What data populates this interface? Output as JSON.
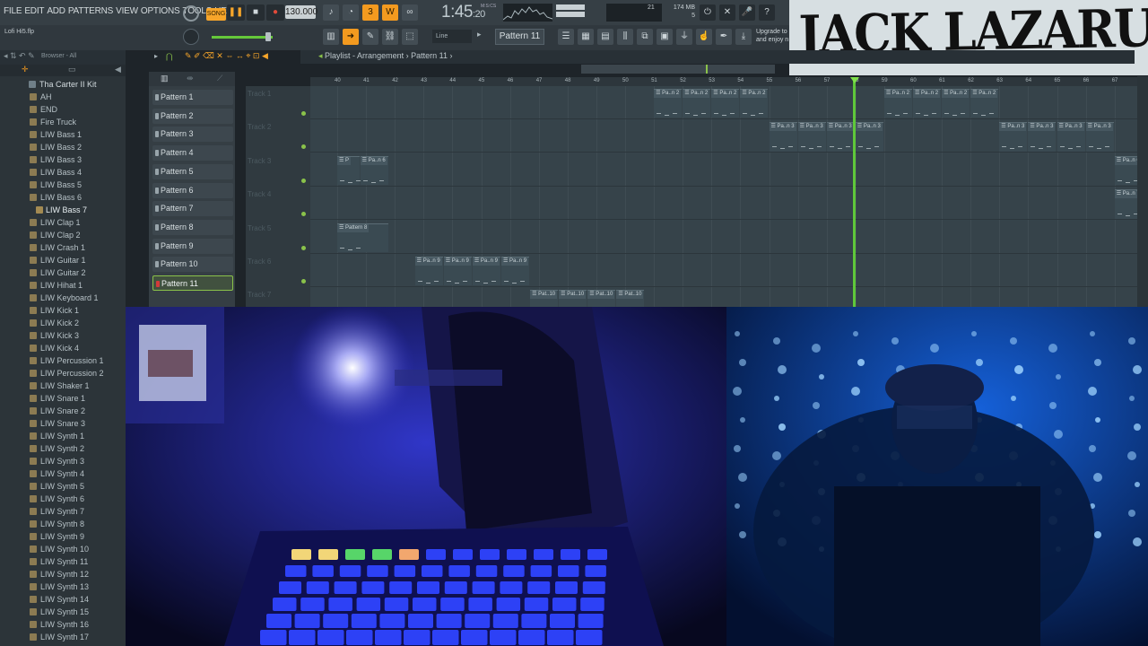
{
  "menu": [
    "FILE",
    "EDIT",
    "ADD",
    "PATTERNS",
    "VIEW",
    "OPTIONS",
    "TOOLS",
    "HELP"
  ],
  "transport": {
    "song_mode": "SONG",
    "tempo": "130.000",
    "time_main": "1:45",
    "time_sub": ":20",
    "time_label": "M:S:CS"
  },
  "memory": {
    "top": "174 MB",
    "bottom": "5",
    "cpu": "21"
  },
  "upgrade": {
    "line1": "Upgrade to",
    "line2": "and enjoy n"
  },
  "toolbar": {
    "snap": "Line",
    "pattern": "Pattern 11"
  },
  "project": {
    "filename": "Lofi Hi5.flp"
  },
  "browser": {
    "label": "Browser - All",
    "items": [
      {
        "label": "Tha Carter II Kit",
        "kind": "head"
      },
      {
        "label": "AH",
        "kind": "folder"
      },
      {
        "label": "END",
        "kind": "folder"
      },
      {
        "label": "Fire Truck",
        "kind": "folder"
      },
      {
        "label": "LIW Bass 1",
        "kind": "folder"
      },
      {
        "label": "LIW Bass 2",
        "kind": "folder"
      },
      {
        "label": "LIW Bass 3",
        "kind": "folder"
      },
      {
        "label": "LIW Bass 4",
        "kind": "folder"
      },
      {
        "label": "LIW Bass 5",
        "kind": "folder"
      },
      {
        "label": "LIW Bass 6",
        "kind": "folder"
      },
      {
        "label": "LIW Bass 7",
        "kind": "selected"
      },
      {
        "label": "LIW Clap 1",
        "kind": "folder"
      },
      {
        "label": "LIW Clap 2",
        "kind": "folder"
      },
      {
        "label": "LIW Crash 1",
        "kind": "folder"
      },
      {
        "label": "LIW Guitar 1",
        "kind": "folder"
      },
      {
        "label": "LIW Guitar 2",
        "kind": "folder"
      },
      {
        "label": "LIW Hihat 1",
        "kind": "folder"
      },
      {
        "label": "LIW Keyboard 1",
        "kind": "folder"
      },
      {
        "label": "LIW Kick 1",
        "kind": "folder"
      },
      {
        "label": "LIW Kick 2",
        "kind": "folder"
      },
      {
        "label": "LIW Kick 3",
        "kind": "folder"
      },
      {
        "label": "LIW Kick 4",
        "kind": "folder"
      },
      {
        "label": "LIW Percussion 1",
        "kind": "folder"
      },
      {
        "label": "LIW Percussion 2",
        "kind": "folder"
      },
      {
        "label": "LIW Shaker 1",
        "kind": "folder"
      },
      {
        "label": "LIW Snare 1",
        "kind": "folder"
      },
      {
        "label": "LIW Snare 2",
        "kind": "folder"
      },
      {
        "label": "LIW Snare 3",
        "kind": "folder"
      },
      {
        "label": "LIW Synth 1",
        "kind": "folder"
      },
      {
        "label": "LIW Synth 2",
        "kind": "folder"
      },
      {
        "label": "LIW Synth 3",
        "kind": "folder"
      },
      {
        "label": "LIW Synth 4",
        "kind": "folder"
      },
      {
        "label": "LIW Synth 5",
        "kind": "folder"
      },
      {
        "label": "LIW Synth 6",
        "kind": "folder"
      },
      {
        "label": "LIW Synth 7",
        "kind": "folder"
      },
      {
        "label": "LIW Synth 8",
        "kind": "folder"
      },
      {
        "label": "LIW Synth 9",
        "kind": "folder"
      },
      {
        "label": "LIW Synth 10",
        "kind": "folder"
      },
      {
        "label": "LIW Synth 11",
        "kind": "folder"
      },
      {
        "label": "LIW Synth 12",
        "kind": "folder"
      },
      {
        "label": "LIW Synth 13",
        "kind": "folder"
      },
      {
        "label": "LIW Synth 14",
        "kind": "folder"
      },
      {
        "label": "LIW Synth 15",
        "kind": "folder"
      },
      {
        "label": "LIW Synth 16",
        "kind": "folder"
      },
      {
        "label": "LIW Synth 17",
        "kind": "folder"
      }
    ]
  },
  "patterns": [
    "Pattern 1",
    "Pattern 2",
    "Pattern 3",
    "Pattern 4",
    "Pattern 5",
    "Pattern 6",
    "Pattern 7",
    "Pattern 8",
    "Pattern 9",
    "Pattern 10",
    "Pattern 11"
  ],
  "selected_pattern_index": 10,
  "playlist": {
    "title": "Playlist - Arrangement",
    "current_pattern": "Pattern 11",
    "tracks": [
      "Track 1",
      "Track 2",
      "Track 3",
      "Track 4",
      "Track 5",
      "Track 6",
      "Track 7"
    ],
    "bar_numbers": [
      40,
      41,
      42,
      43,
      44,
      45,
      46,
      47,
      48,
      49,
      50,
      51,
      52,
      53,
      54,
      55,
      56,
      57,
      58,
      59,
      60,
      61,
      62,
      63,
      64,
      65,
      66,
      67
    ],
    "playhead_bar": 57.9,
    "clips": [
      {
        "track": 0,
        "bar": 51.0,
        "len": 1.0,
        "label": "Pa..n 2"
      },
      {
        "track": 0,
        "bar": 52.0,
        "len": 1.0,
        "label": "Pa..n 2"
      },
      {
        "track": 0,
        "bar": 53.0,
        "len": 1.0,
        "label": "Pa..n 2"
      },
      {
        "track": 0,
        "bar": 54.0,
        "len": 1.0,
        "label": "Pa..n 2"
      },
      {
        "track": 0,
        "bar": 59.0,
        "len": 1.0,
        "label": "Pa..n 2"
      },
      {
        "track": 0,
        "bar": 60.0,
        "len": 1.0,
        "label": "Pa..n 2"
      },
      {
        "track": 0,
        "bar": 61.0,
        "len": 1.0,
        "label": "Pa..n 2"
      },
      {
        "track": 0,
        "bar": 62.0,
        "len": 1.0,
        "label": "Pa..n 2"
      },
      {
        "track": 1,
        "bar": 55.0,
        "len": 1.0,
        "label": "Pa..n 3"
      },
      {
        "track": 1,
        "bar": 56.0,
        "len": 1.0,
        "label": "Pa..n 3"
      },
      {
        "track": 1,
        "bar": 57.0,
        "len": 1.0,
        "label": "Pa..n 3"
      },
      {
        "track": 1,
        "bar": 58.0,
        "len": 1.0,
        "label": "Pa..n 3"
      },
      {
        "track": 1,
        "bar": 63.0,
        "len": 1.0,
        "label": "Pa..n 3"
      },
      {
        "track": 1,
        "bar": 64.0,
        "len": 1.0,
        "label": "Pa..n 3"
      },
      {
        "track": 1,
        "bar": 65.0,
        "len": 1.0,
        "label": "Pa..n 3"
      },
      {
        "track": 1,
        "bar": 66.0,
        "len": 1.0,
        "label": "Pa..n 3"
      },
      {
        "track": 2,
        "bar": 40.0,
        "len": 0.8,
        "label": "P"
      },
      {
        "track": 2,
        "bar": 40.8,
        "len": 1.0,
        "label": "Pa..n 6"
      },
      {
        "track": 2,
        "bar": 67.0,
        "len": 1.0,
        "label": "Pa..n 6"
      },
      {
        "track": 3,
        "bar": 67.0,
        "len": 1.0,
        "label": "Pa..n 7"
      },
      {
        "track": 4,
        "bar": 40.0,
        "len": 1.8,
        "label": "Pattern 8"
      },
      {
        "track": 5,
        "bar": 42.7,
        "len": 1.0,
        "label": "Pa..n 9"
      },
      {
        "track": 5,
        "bar": 43.7,
        "len": 1.0,
        "label": "Pa..n 9"
      },
      {
        "track": 5,
        "bar": 44.7,
        "len": 1.0,
        "label": "Pa..n 9"
      },
      {
        "track": 5,
        "bar": 45.7,
        "len": 1.0,
        "label": "Pa..n 9"
      },
      {
        "track": 6,
        "bar": 46.7,
        "len": 1.0,
        "label": "Pat..10"
      },
      {
        "track": 6,
        "bar": 47.7,
        "len": 1.0,
        "label": "Pat..10"
      },
      {
        "track": 6,
        "bar": 48.7,
        "len": 1.0,
        "label": "Pat..10"
      },
      {
        "track": 6,
        "bar": 49.7,
        "len": 1.0,
        "label": "Pat..10"
      }
    ]
  },
  "logo": {
    "text": "JACK LAZARUS"
  },
  "colors": {
    "accent": "#8ac24a",
    "orange": "#f39a1f",
    "playhead": "#5fc83a"
  }
}
